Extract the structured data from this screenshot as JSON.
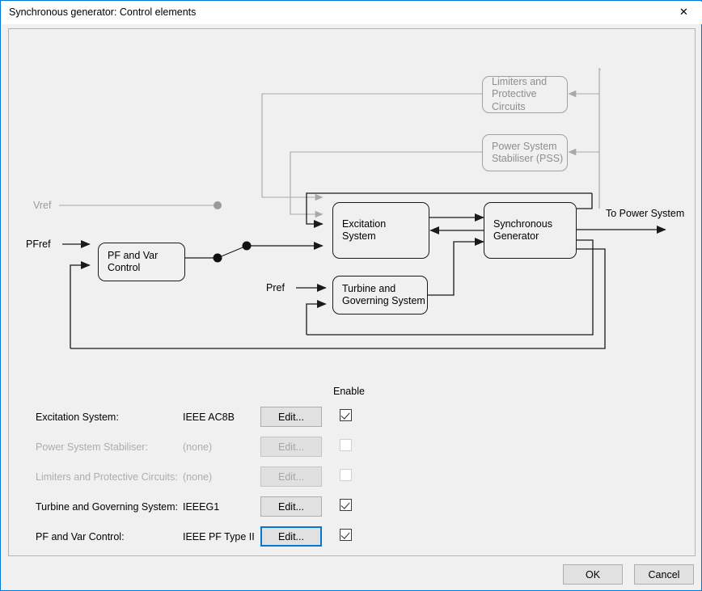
{
  "window": {
    "title": "Synchronous generator: Control elements",
    "close_icon": "close-icon"
  },
  "diagram": {
    "blocks": [
      {
        "id": "limiters",
        "label": "Limiters and\nProtective\nCircuits",
        "enabled": false
      },
      {
        "id": "pss",
        "label": "Power System\nStabiliser (PSS)",
        "enabled": false
      },
      {
        "id": "excitation",
        "label": "Excitation\nSystem",
        "enabled": true
      },
      {
        "id": "syncgen",
        "label": "Synchronous\nGenerator",
        "enabled": true
      },
      {
        "id": "turbine",
        "label": "Turbine and\nGoverning System",
        "enabled": true
      },
      {
        "id": "pfvar",
        "label": "PF and Var\nControl",
        "enabled": true
      }
    ],
    "labels": [
      {
        "id": "vref",
        "text": "Vref",
        "enabled": false
      },
      {
        "id": "pfref",
        "text": "PFref",
        "enabled": true
      },
      {
        "id": "pref",
        "text": "Pref",
        "enabled": true
      },
      {
        "id": "out",
        "text": "To Power System",
        "enabled": true
      }
    ],
    "colors": {
      "active_line": "#1a1a1a",
      "disabled_line": "#a8a8a8",
      "panel_bg": "#f0f0f0",
      "panel_border": "#b4b4b4"
    }
  },
  "form": {
    "enable_header": "Enable",
    "rows": [
      {
        "label": "Excitation System:",
        "model": "IEEE AC8B",
        "button": "Edit...",
        "checked": true,
        "enabled": true,
        "focused": false
      },
      {
        "label": "Power System Stabiliser:",
        "model": "(none)",
        "button": "Edit...",
        "checked": false,
        "enabled": false,
        "focused": false
      },
      {
        "label": "Limiters and Protective Circuits:",
        "model": "(none)",
        "button": "Edit...",
        "checked": false,
        "enabled": false,
        "focused": false
      },
      {
        "label": "Turbine and Governing System:",
        "model": "IEEEG1",
        "button": "Edit...",
        "checked": true,
        "enabled": true,
        "focused": false
      },
      {
        "label": "PF and Var Control:",
        "model": "IEEE PF Type II",
        "button": "Edit...",
        "checked": true,
        "enabled": true,
        "focused": true
      }
    ]
  },
  "footer": {
    "ok_label": "OK",
    "cancel_label": "Cancel"
  },
  "theme": {
    "accent": "#0078d7",
    "dialog_bg": "#f0f0f0",
    "titlebar_bg": "#ffffff"
  }
}
